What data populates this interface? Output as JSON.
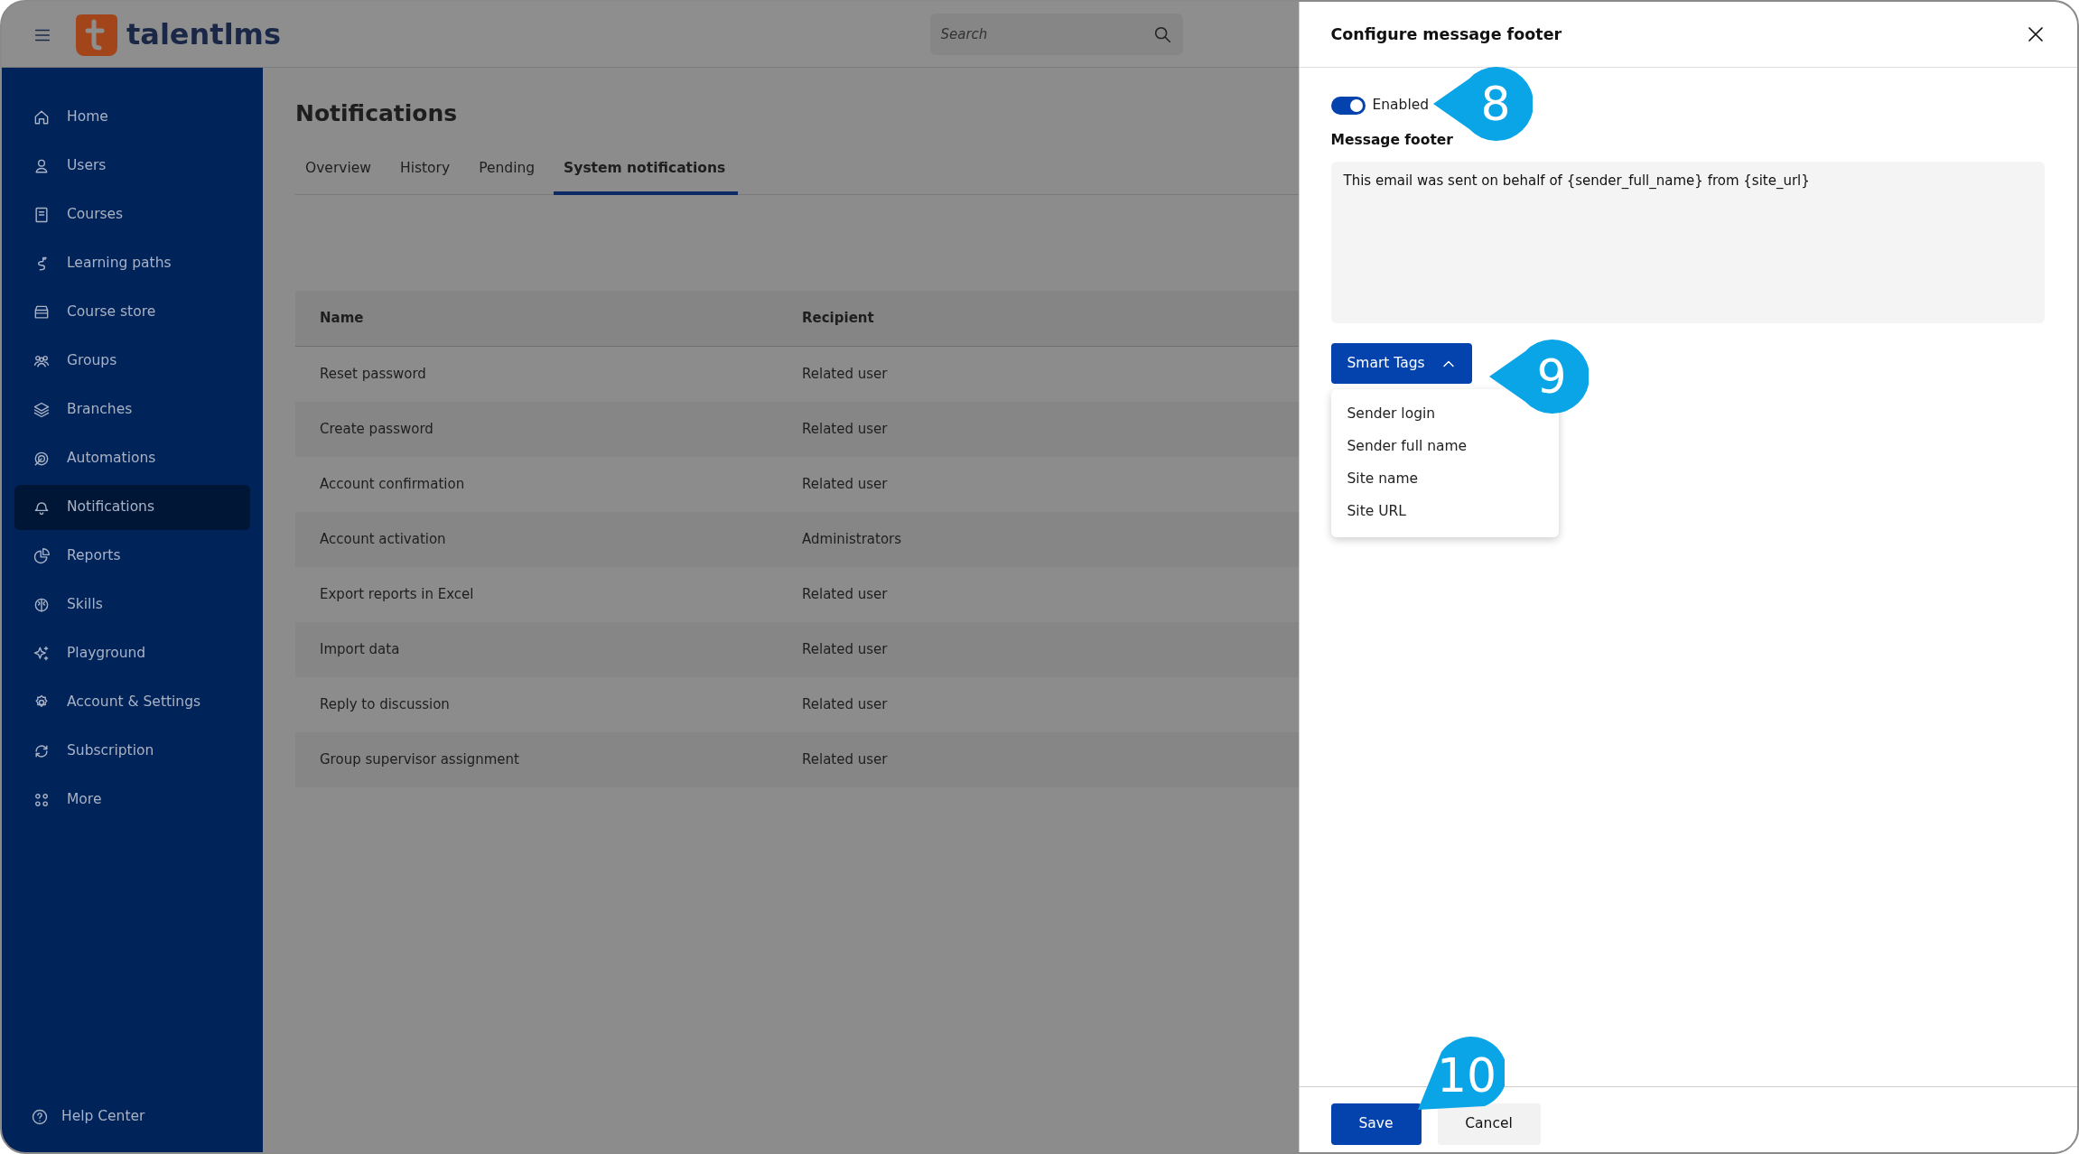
{
  "header": {
    "logo_text": "talentlms",
    "search": {
      "placeholder": "Search"
    }
  },
  "sidebar": {
    "items": [
      {
        "label": "Home",
        "selected": false
      },
      {
        "label": "Users",
        "selected": false
      },
      {
        "label": "Courses",
        "selected": false
      },
      {
        "label": "Learning paths",
        "selected": false
      },
      {
        "label": "Course store",
        "selected": false
      },
      {
        "label": "Groups",
        "selected": false
      },
      {
        "label": "Branches",
        "selected": false
      },
      {
        "label": "Automations",
        "selected": false
      },
      {
        "label": "Notifications",
        "selected": true
      },
      {
        "label": "Reports",
        "selected": false
      },
      {
        "label": "Skills",
        "selected": false
      },
      {
        "label": "Playground",
        "selected": false
      },
      {
        "label": "Account & Settings",
        "selected": false
      },
      {
        "label": "Subscription",
        "selected": false
      },
      {
        "label": "More",
        "selected": false
      }
    ],
    "footer": "Help Center"
  },
  "page": {
    "title": "Notifications",
    "tabs": [
      {
        "label": "Overview",
        "selected": false
      },
      {
        "label": "History",
        "selected": false
      },
      {
        "label": "Pending",
        "selected": false
      },
      {
        "label": "System notifications",
        "selected": true
      }
    ],
    "table": {
      "columns": [
        "Name",
        "Recipient"
      ],
      "rows": [
        [
          "Reset password",
          "Related user"
        ],
        [
          "Create password",
          "Related user"
        ],
        [
          "Account confirmation",
          "Related user"
        ],
        [
          "Account activation",
          "Administrators"
        ],
        [
          "Export reports in Excel",
          "Related user"
        ],
        [
          "Import data",
          "Related user"
        ],
        [
          "Reply to discussion",
          "Related user"
        ],
        [
          "Group supervisor assignment",
          "Related user"
        ]
      ]
    }
  },
  "drawer": {
    "title": "Configure message footer",
    "toggle": {
      "label": "Enabled",
      "on": true
    },
    "field_label": "Message footer",
    "footer_text": "This email was sent on behalf of {sender_full_name} from {site_url}",
    "smart_tags": {
      "label": "Smart Tags",
      "expanded": true,
      "options": [
        "Sender login",
        "Sender full name",
        "Site name",
        "Site URL"
      ]
    },
    "buttons": [
      "Save",
      "Cancel"
    ]
  },
  "callouts": [
    "8",
    "9",
    "10"
  ]
}
